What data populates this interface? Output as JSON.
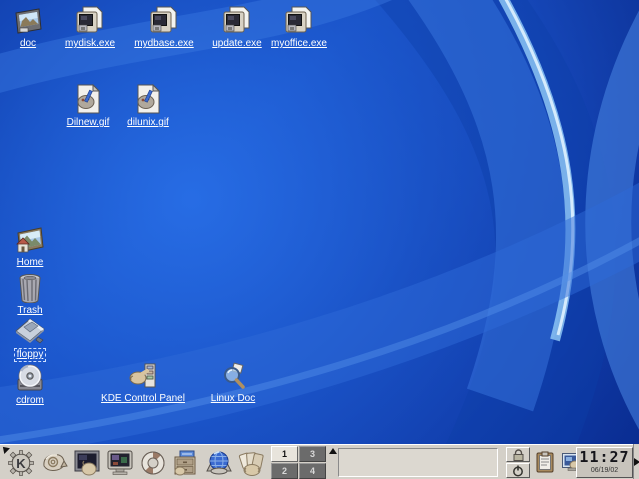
{
  "desktop": {
    "icons": {
      "doc": {
        "label": "doc"
      },
      "exe1": {
        "label": "mydisk.exe"
      },
      "exe2": {
        "label": "mydbase.exe"
      },
      "exe3": {
        "label": "update.exe"
      },
      "exe4": {
        "label": "myoffice.exe"
      },
      "gif1": {
        "label": "Dilnew.gif"
      },
      "gif2": {
        "label": "dilunix.gif"
      },
      "home": {
        "label": "Home"
      },
      "trash": {
        "label": "Trash"
      },
      "floppy": {
        "label": "floppy"
      },
      "cdrom": {
        "label": "cdrom"
      },
      "control_panel": {
        "label": "KDE Control Panel"
      },
      "linux_doc": {
        "label": "Linux Doc"
      }
    }
  },
  "panel": {
    "launcher_icons": [
      "k-menu-icon",
      "shell-icon",
      "terminal-icon",
      "display-icon",
      "help-lifering-icon",
      "file-cabinet-icon",
      "globe-icon",
      "cards-icon"
    ],
    "pager": {
      "cells": [
        "1",
        "3",
        "2",
        "4"
      ],
      "active": "1"
    },
    "tray_icons": [
      "clipboard-icon",
      "monitor-icon"
    ],
    "mini_buttons": [
      "lock-icon",
      "power-icon"
    ],
    "clock": {
      "time": "11:27",
      "date": "06/19/02"
    }
  },
  "colors": {
    "wallpaper_base": "#1a52c6",
    "wallpaper_highlight": "#8cc4f4",
    "panel_bg": "#d4d0c8",
    "icon_label": "#ffffff"
  }
}
